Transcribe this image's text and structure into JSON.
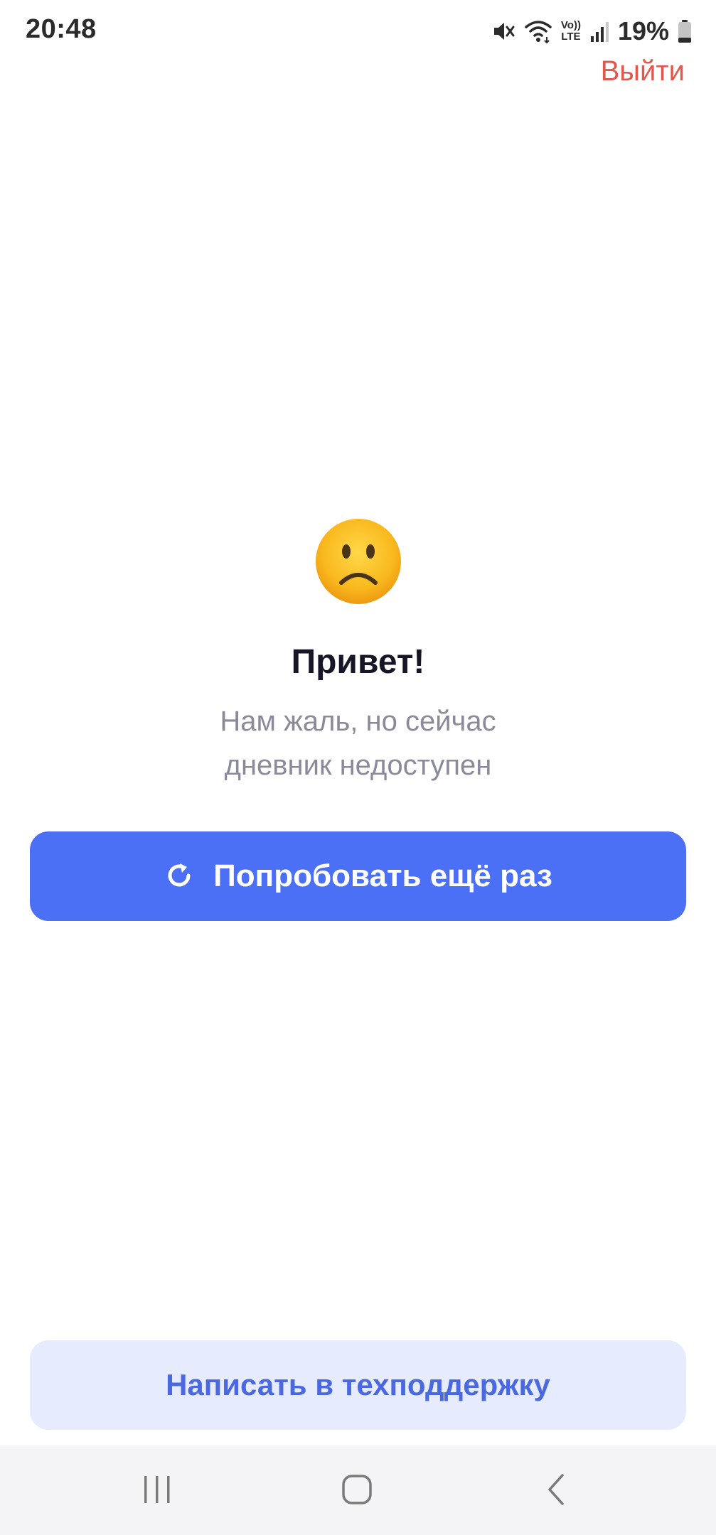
{
  "status_bar": {
    "time": "20:48",
    "battery_percent": "19%",
    "icons": [
      "mute-icon",
      "wifi-icon",
      "volte-icon",
      "signal-icon",
      "battery-icon"
    ],
    "volte_text_top": "Vo))",
    "volte_text_bottom": "LTE"
  },
  "header": {
    "logout_label": "Выйти"
  },
  "main": {
    "emoji": "sad-face-icon",
    "greeting": "Привет!",
    "message_line1": "Нам жаль, но сейчас",
    "message_line2": "дневник недоступен",
    "retry_label": "Попробовать ещё раз",
    "retry_icon": "refresh-icon"
  },
  "footer": {
    "support_label": "Написать в техподдержку"
  },
  "nav_bar": {
    "buttons": [
      "recents-icon",
      "home-icon",
      "back-icon"
    ]
  },
  "colors": {
    "accent": "#4b70f5",
    "logout": "#e2574c",
    "support_bg": "#e6ebfd",
    "support_text": "#4a68e0",
    "muted_text": "#8a8a9a"
  }
}
